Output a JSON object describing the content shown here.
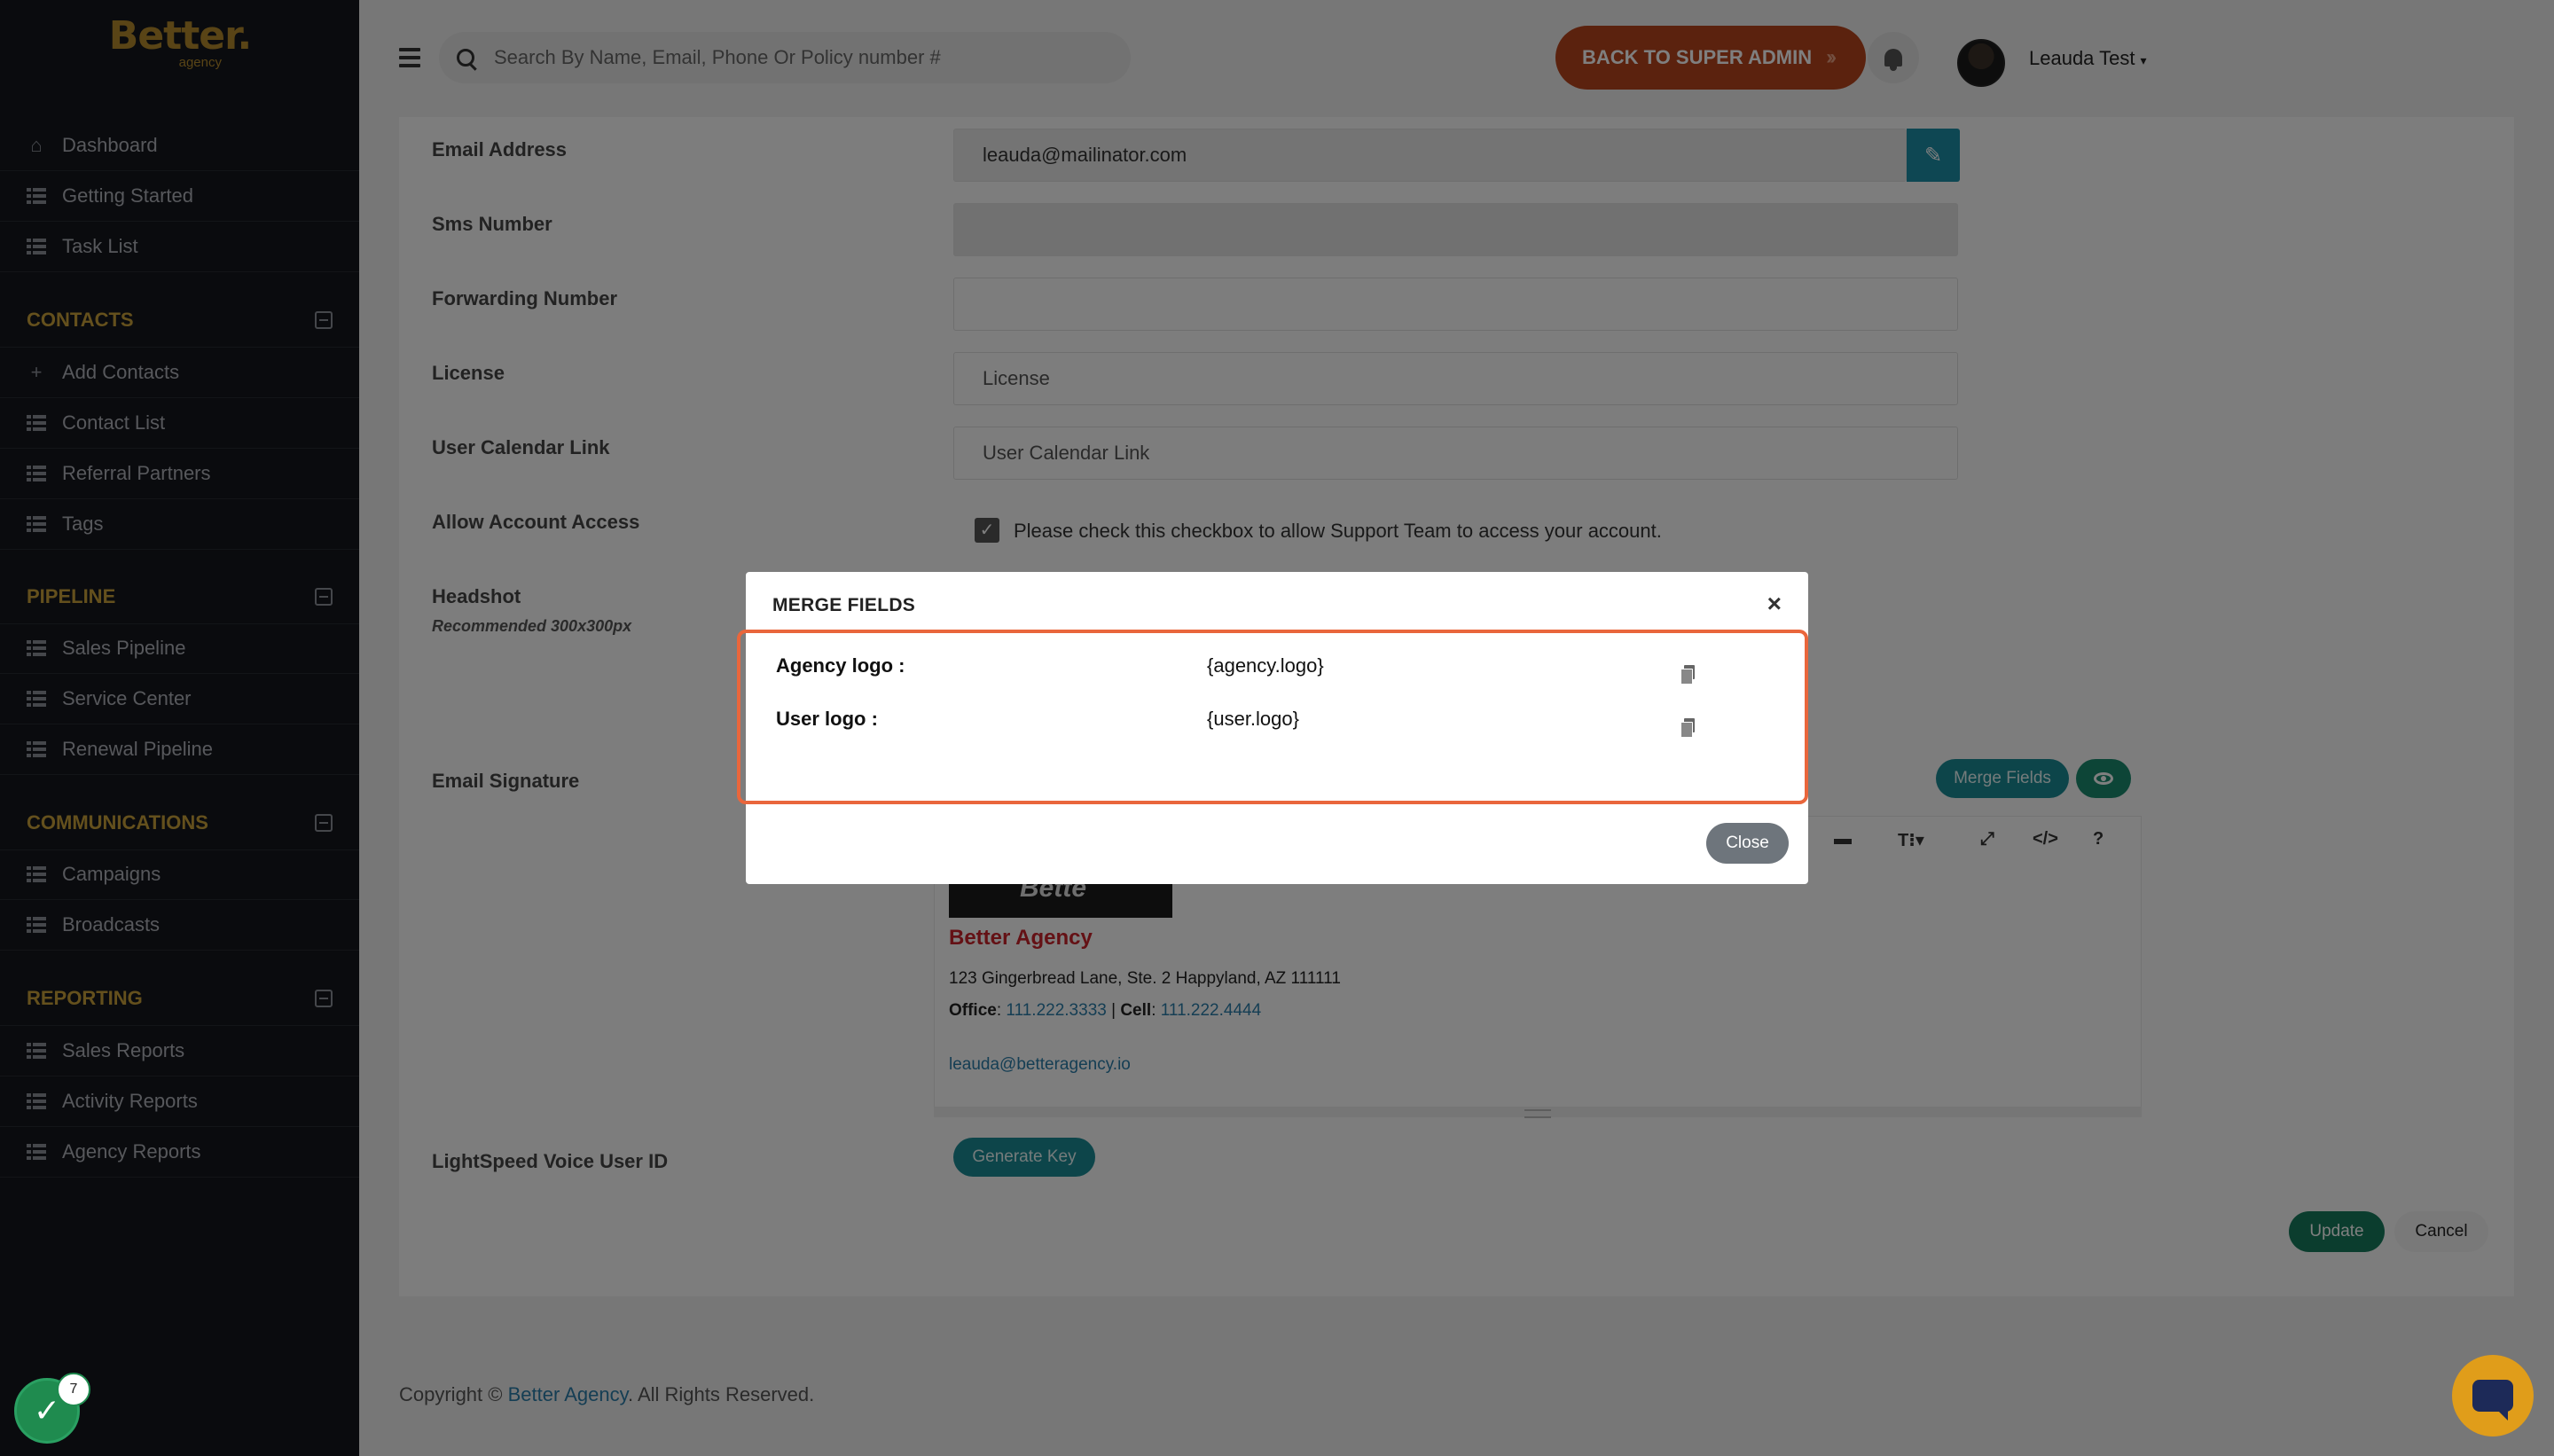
{
  "brand": {
    "name": "Better.",
    "sub": "agency"
  },
  "sidebar": {
    "top_items": [
      {
        "label": "Dashboard",
        "icon": "home-icon"
      },
      {
        "label": "Getting Started",
        "icon": "list-icon"
      },
      {
        "label": "Task List",
        "icon": "list-icon"
      }
    ],
    "sections": [
      {
        "title": "CONTACTS",
        "items": [
          "Add Contacts",
          "Contact List",
          "Referral Partners",
          "Tags"
        ]
      },
      {
        "title": "PIPELINE",
        "items": [
          "Sales Pipeline",
          "Service Center",
          "Renewal Pipeline"
        ]
      },
      {
        "title": "COMMUNICATIONS",
        "items": [
          "Campaigns",
          "Broadcasts"
        ]
      },
      {
        "title": "REPORTING",
        "items": [
          "Sales Reports",
          "Activity Reports",
          "Agency Reports"
        ]
      }
    ]
  },
  "header": {
    "search_placeholder": "Search By Name, Email, Phone Or Policy number #",
    "super_admin_label": "BACK TO SUPER ADMIN",
    "user_name": "Leauda Test"
  },
  "form": {
    "email_label": "Email Address",
    "email_value": "leauda@mailinator.com",
    "sms_label": "Sms Number",
    "forwarding_label": "Forwarding Number",
    "license_label": "License",
    "license_placeholder": "License",
    "calendar_label": "User Calendar Link",
    "calendar_placeholder": "User Calendar Link",
    "access_label": "Allow Account Access",
    "access_text": "Please check this checkbox to allow Support Team to access your account.",
    "access_checked": true,
    "headshot_label": "Headshot",
    "headshot_hint": "Recommended 300x300px",
    "signature_label": "Email Signature",
    "merge_fields_btn": "Merge Fields",
    "lightspeed_label": "LightSpeed Voice User ID",
    "generate_key_btn": "Generate Key",
    "update_btn": "Update",
    "cancel_btn": "Cancel"
  },
  "signature": {
    "photo_text": "Bette",
    "company": "Better Agency",
    "address": "123 Gingerbread Lane, Ste. 2 Happyland, AZ 111111",
    "office_label": "Office",
    "office_phone": "111.222.3333",
    "cell_label": "Cell",
    "cell_phone": "111.222.4444",
    "email": "leauda@betteragency.io"
  },
  "modal": {
    "title": "MERGE FIELDS",
    "fields": [
      {
        "label": "Agency logo :",
        "value": "{agency.logo}"
      },
      {
        "label": "User logo :",
        "value": "{user.logo}"
      }
    ],
    "close_btn": "Close"
  },
  "footer": {
    "prefix": "Copyright ©",
    "link": "Better Agency",
    "suffix": ". All Rights Reserved."
  },
  "notifications": {
    "task_badge": "7"
  },
  "colors": {
    "accent": "#b3892c",
    "primary_teal": "#1b8a94",
    "admin_orange": "#b6441d",
    "highlight": "#e9663c"
  }
}
